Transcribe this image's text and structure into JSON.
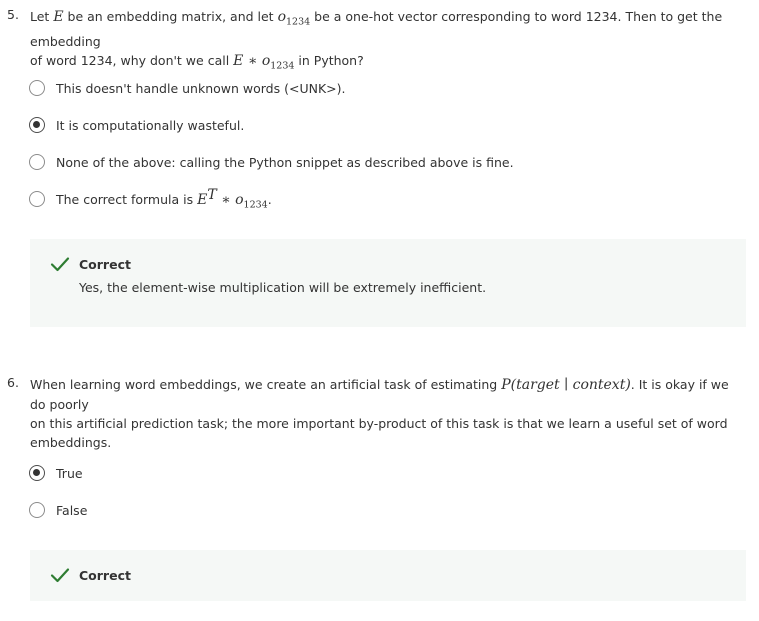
{
  "q5": {
    "number": "5.",
    "line1_a": "Let ",
    "E": "E",
    "line1_b": " be an embedding matrix, and let ",
    "o": "o",
    "sub": "1234",
    "line1_c": " be a one-hot vector corresponding to word 1234. Then to get the embedding",
    "line2_a": "of word 1234, why don't we call ",
    "star": " ∗ ",
    "line2_b": " in Python?",
    "options": [
      {
        "label": "This doesn't handle unknown words (<UNK>).",
        "selected": false
      },
      {
        "label": "It is computationally wasteful.",
        "selected": true
      },
      {
        "label": "None of the above: calling the Python snippet as described above is fine.",
        "selected": false
      },
      {
        "label_a": "The correct formula is ",
        "E": "E",
        "sup": "T",
        "star": " ∗ ",
        "o": "o",
        "sub": "1234",
        "label_b": ".",
        "selected": false
      }
    ],
    "feedback": {
      "title": "Correct",
      "text": "Yes, the element-wise multiplication will be extremely inefficient."
    }
  },
  "q6": {
    "number": "6.",
    "text_a": "When learning word embeddings, we create an artificial task of estimating ",
    "math": "P(target ∣ context)",
    "text_b": ". It is okay if we do poorly",
    "line2": "on this artificial prediction task; the more important by-product of this task is that we learn a useful set of word",
    "line3": "embeddings.",
    "options": [
      {
        "label": "True",
        "selected": true
      },
      {
        "label": "False",
        "selected": false
      }
    ],
    "feedback": {
      "title": "Correct"
    }
  },
  "colors": {
    "check": "#2e7d32",
    "feedback_bg": "#f5f8f6",
    "text": "#333333"
  }
}
